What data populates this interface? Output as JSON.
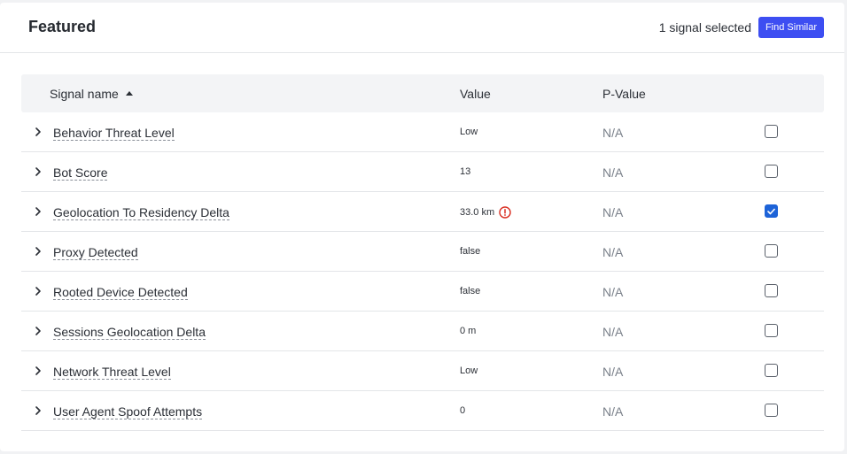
{
  "header": {
    "title": "Featured",
    "selected_text": "1 signal selected",
    "find_similar_label": "Find Similar"
  },
  "table": {
    "columns": {
      "name": "Signal name",
      "value": "Value",
      "pvalue": "P-Value"
    },
    "rows": [
      {
        "name": "Behavior Threat Level",
        "value": "Low",
        "pvalue": "N/A",
        "checked": false,
        "warning": false
      },
      {
        "name": "Bot Score",
        "value": "13",
        "pvalue": "N/A",
        "checked": false,
        "warning": false
      },
      {
        "name": "Geolocation To Residency Delta",
        "value": "33.0 km",
        "pvalue": "N/A",
        "checked": true,
        "warning": true
      },
      {
        "name": "Proxy Detected",
        "value": "false",
        "pvalue": "N/A",
        "checked": false,
        "warning": false
      },
      {
        "name": "Rooted Device Detected",
        "value": "false",
        "pvalue": "N/A",
        "checked": false,
        "warning": false
      },
      {
        "name": "Sessions Geolocation Delta",
        "value": "0 m",
        "pvalue": "N/A",
        "checked": false,
        "warning": false
      },
      {
        "name": "Network Threat Level",
        "value": "Low",
        "pvalue": "N/A",
        "checked": false,
        "warning": false
      },
      {
        "name": "User Agent Spoof Attempts",
        "value": "0",
        "pvalue": "N/A",
        "checked": false,
        "warning": false
      }
    ]
  },
  "colors": {
    "accent": "#3d4ef2",
    "checkbox_checked": "#1d63d8",
    "warning": "#d92d20"
  },
  "icons": {
    "sort": "sort-ascending-icon",
    "expand": "chevron-right-icon",
    "warning": "alert-circle-icon",
    "check": "check-icon"
  }
}
